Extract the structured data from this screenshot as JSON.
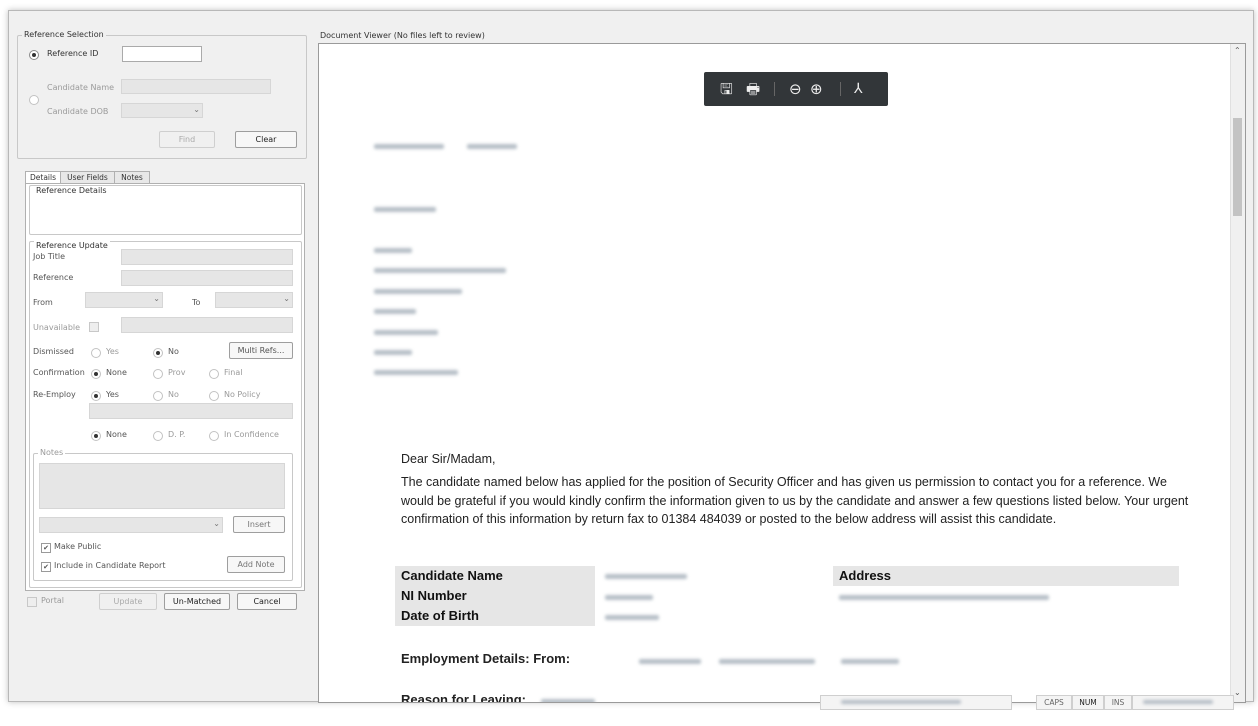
{
  "reference_selection": {
    "title": "Reference Selection",
    "reference_id_label": "Reference ID",
    "reference_id_value": "",
    "candidate_name_label": "Candidate Name",
    "candidate_dob_label": "Candidate DOB",
    "find_label": "Find",
    "clear_label": "Clear"
  },
  "tabs": [
    "Details",
    "User Fields",
    "Notes"
  ],
  "reference_details": {
    "title": "Reference Details"
  },
  "reference_update": {
    "title": "Reference Update",
    "job_title_label": "Job Title",
    "reference_label": "Reference",
    "from_label": "From",
    "to_label": "To",
    "unavailable_label": "Unavailable",
    "dismissed_label": "Dismissed",
    "dismissed_options": [
      "Yes",
      "No"
    ],
    "multi_refs_label": "Multi Refs...",
    "confirmation_label": "Confirmation",
    "confirmation_options": [
      "None",
      "Prov",
      "Final"
    ],
    "reemploy_label": "Re-Employ",
    "reemploy_options": [
      "Yes",
      "No",
      "No Policy"
    ],
    "reemploy_sub_options": [
      "None",
      "D. P.",
      "In Confidence"
    ],
    "notes_title": "Notes",
    "insert_label": "Insert",
    "make_public_label": "Make Public",
    "include_report_label": "Include in Candidate Report",
    "add_note_label": "Add Note"
  },
  "bottom_bar": {
    "portal_label": "Portal",
    "update_label": "Update",
    "unmatched_label": "Un-Matched",
    "cancel_label": "Cancel"
  },
  "viewer": {
    "title": "Document Viewer (No files left to review)",
    "toolbar_icons": [
      "save-icon",
      "print-icon",
      "zoom-out-icon",
      "zoom-in-icon",
      "pdf-icon"
    ],
    "salutation": "Dear Sir/Madam,",
    "body": "The candidate named below has applied for the position of Security Officer and has given us permission to contact you for a reference.  We would be grateful if you would kindly confirm the information given to us by the candidate and answer a few questions listed below. Your urgent confirmation of this information by return fax to 01384 484039 or posted to the below address will assist this candidate.",
    "candidate_name_label": "Candidate Name",
    "ni_number_label": "NI Number",
    "dob_label": "Date of Birth",
    "address_label": "Address",
    "employment_label": "Employment Details:  From:",
    "reason_label": "Reason for Leaving:"
  },
  "status_bar": {
    "caps": "CAPS",
    "num": "NUM",
    "ins": "INS"
  }
}
